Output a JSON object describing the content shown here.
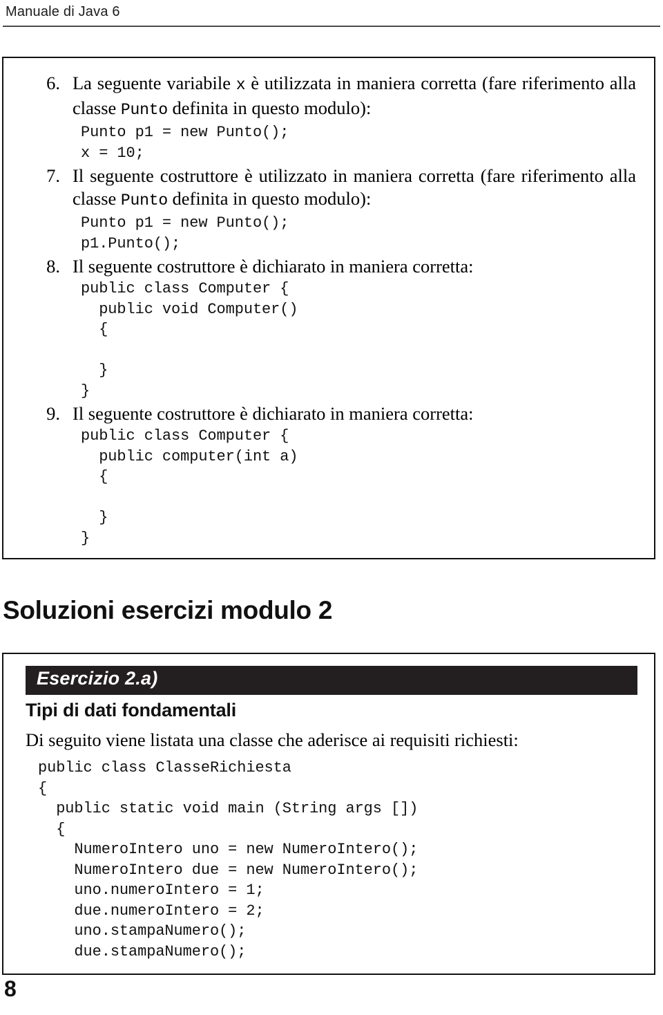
{
  "header": {
    "running_head": "Manuale di Java 6"
  },
  "questions_box": {
    "items": [
      {
        "number": "6.",
        "text_parts": [
          {
            "type": "text",
            "value": "La seguente variabile "
          },
          {
            "type": "code",
            "value": "x"
          },
          {
            "type": "text",
            "value": " è utilizzata in maniera corretta (fare riferimento alla classe "
          },
          {
            "type": "code",
            "value": "Punto"
          },
          {
            "type": "text",
            "value": " definita in questo modulo):"
          }
        ],
        "plain_text": "La seguente variabile x è utilizzata in maniera corretta (fare riferimento alla classe Punto definita in questo modulo):",
        "code": "Punto p1 = new Punto();\nx = 10;"
      },
      {
        "number": "7.",
        "text_parts": [
          {
            "type": "text",
            "value": "Il seguente costruttore è utilizzato in maniera corretta (fare riferimento alla classe "
          },
          {
            "type": "code",
            "value": "Punto"
          },
          {
            "type": "text",
            "value": " definita in questo modulo):"
          }
        ],
        "plain_text": "Il seguente costruttore è utilizzato in maniera corretta (fare riferimento alla classe Punto definita in questo modulo):",
        "code": "Punto p1 = new Punto();\np1.Punto();"
      },
      {
        "number": "8.",
        "text_parts": [
          {
            "type": "text",
            "value": "Il seguente costruttore è dichiarato in maniera corretta:"
          }
        ],
        "plain_text": "Il seguente costruttore è dichiarato in maniera corretta:",
        "code": "public class Computer {\n  public void Computer()\n  {\n\n  }\n}"
      },
      {
        "number": "9.",
        "text_parts": [
          {
            "type": "text",
            "value": "Il seguente costruttore è dichiarato in maniera corretta:"
          }
        ],
        "plain_text": "Il seguente costruttore è dichiarato in maniera corretta:",
        "code": "public class Computer {\n  public computer(int a)\n  {\n\n  }\n}"
      }
    ]
  },
  "section": {
    "title": "Soluzioni esercizi modulo 2"
  },
  "solution_box": {
    "banner_label": "Esercizio 2.a)",
    "subtitle": "Tipi di dati fondamentali",
    "intro": "Di seguito viene listata una classe che aderisce ai requisiti richiesti:",
    "code": "public class ClasseRichiesta\n{\n  public static void main (String args [])\n  {\n    NumeroIntero uno = new NumeroIntero();\n    NumeroIntero due = new NumeroIntero();\n    uno.numeroIntero = 1;\n    due.numeroIntero = 2;\n    uno.stampaNumero();\n    due.stampaNumero();"
  },
  "footer": {
    "page_number": "8"
  },
  "colors": {
    "banner_background": "#231f20",
    "banner_text": "#ffffff",
    "box_border": "#111111",
    "rule": "#4a4a4a",
    "body_text": "#000000"
  }
}
